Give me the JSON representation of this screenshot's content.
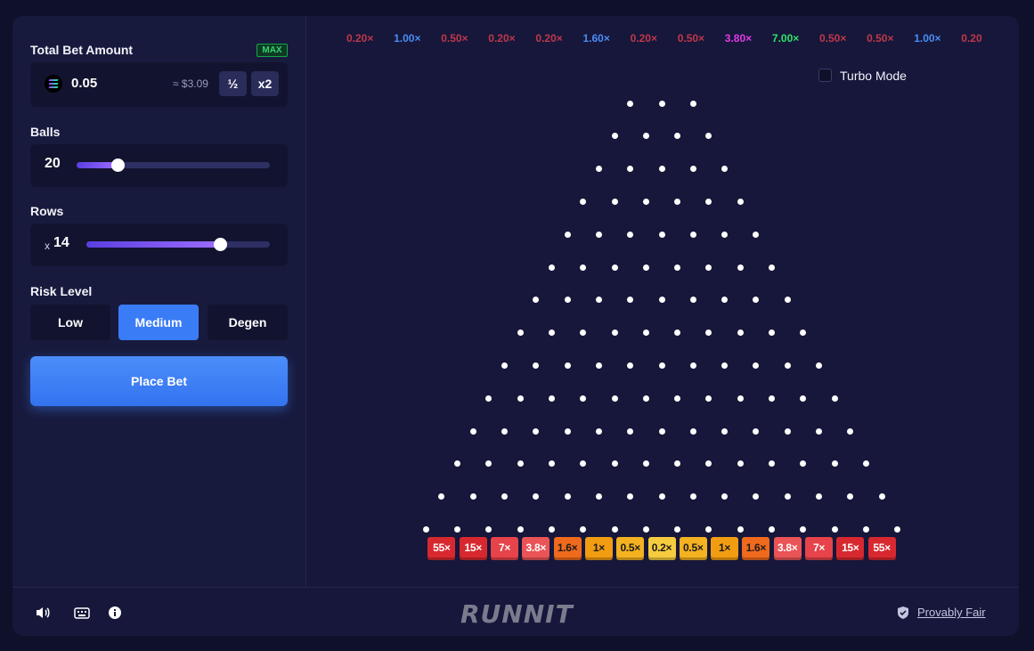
{
  "sidebar": {
    "total_bet_label": "Total Bet Amount",
    "max_label": "MAX",
    "bet_value": "0.05",
    "bet_usd": "≈ $3.09",
    "half_label": "½",
    "double_label": "x2",
    "balls_label": "Balls",
    "balls_value": "20",
    "balls_fraction": 0.21,
    "rows_label": "Rows",
    "rows_prefix": "x",
    "rows_value": "14",
    "rows_fraction": 0.73,
    "risk_label": "Risk Level",
    "risk_options": [
      "Low",
      "Medium",
      "Degen"
    ],
    "risk_selected": "Medium",
    "place_bet_label": "Place Bet"
  },
  "board": {
    "history": [
      {
        "text": "0.20×",
        "color": "#c0384a"
      },
      {
        "text": "1.00×",
        "color": "#4a8cf5"
      },
      {
        "text": "0.50×",
        "color": "#c0384a"
      },
      {
        "text": "0.20×",
        "color": "#c0384a"
      },
      {
        "text": "0.20×",
        "color": "#c0384a"
      },
      {
        "text": "1.60×",
        "color": "#4a8cf5"
      },
      {
        "text": "0.20×",
        "color": "#c0384a"
      },
      {
        "text": "0.50×",
        "color": "#c0384a"
      },
      {
        "text": "3.80×",
        "color": "#e43ae6"
      },
      {
        "text": "7.00×",
        "color": "#2ee36a"
      },
      {
        "text": "0.50×",
        "color": "#c0384a"
      },
      {
        "text": "0.50×",
        "color": "#c0384a"
      },
      {
        "text": "1.00×",
        "color": "#4a8cf5"
      },
      {
        "text": "0.20",
        "color": "#c0384a"
      }
    ],
    "turbo_label": "Turbo Mode",
    "rows": 14,
    "buckets": [
      {
        "text": "55×",
        "bg": "#d8282f",
        "fg": "#ffffff"
      },
      {
        "text": "15×",
        "bg": "#d8282f",
        "fg": "#ffffff"
      },
      {
        "text": "7×",
        "bg": "#e6434a",
        "fg": "#ffffff"
      },
      {
        "text": "3.8×",
        "bg": "#ea5457",
        "fg": "#ffffff"
      },
      {
        "text": "1.6×",
        "bg": "#ef6a1c",
        "fg": "#1a1a1a"
      },
      {
        "text": "1×",
        "bg": "#f29c12",
        "fg": "#1a1a1a"
      },
      {
        "text": "0.5×",
        "bg": "#f4b221",
        "fg": "#1a1a1a"
      },
      {
        "text": "0.2×",
        "bg": "#f6cc3e",
        "fg": "#1a1a1a"
      },
      {
        "text": "0.5×",
        "bg": "#f4b221",
        "fg": "#1a1a1a"
      },
      {
        "text": "1×",
        "bg": "#f29c12",
        "fg": "#1a1a1a"
      },
      {
        "text": "1.6×",
        "bg": "#ef6a1c",
        "fg": "#1a1a1a"
      },
      {
        "text": "3.8×",
        "bg": "#ea5457",
        "fg": "#ffffff"
      },
      {
        "text": "7×",
        "bg": "#e6434a",
        "fg": "#ffffff"
      },
      {
        "text": "15×",
        "bg": "#d8282f",
        "fg": "#ffffff"
      },
      {
        "text": "55×",
        "bg": "#d8282f",
        "fg": "#ffffff"
      }
    ]
  },
  "footer": {
    "logo": "RUNNIT",
    "provably_fair": "Provably Fair",
    "icons": [
      "volume-icon",
      "keyboard-icon",
      "info-icon",
      "shield-check-icon"
    ]
  },
  "colors": {
    "accent": "#3a7cf5",
    "background": "#16173a",
    "panel": "#12132f"
  }
}
